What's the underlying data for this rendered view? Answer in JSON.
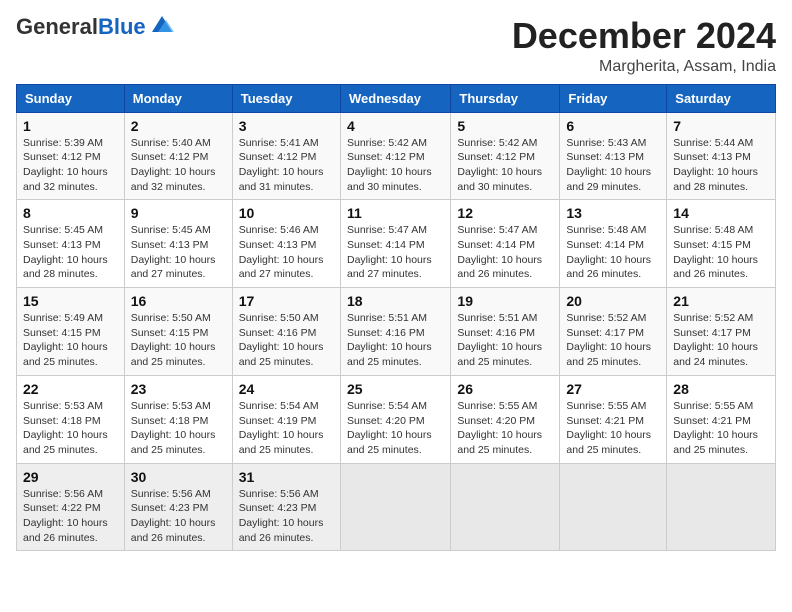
{
  "logo": {
    "general": "General",
    "blue": "Blue"
  },
  "header": {
    "month": "December 2024",
    "location": "Margherita, Assam, India"
  },
  "weekdays": [
    "Sunday",
    "Monday",
    "Tuesday",
    "Wednesday",
    "Thursday",
    "Friday",
    "Saturday"
  ],
  "weeks": [
    [
      {
        "day": "1",
        "sunrise": "Sunrise: 5:39 AM",
        "sunset": "Sunset: 4:12 PM",
        "daylight": "Daylight: 10 hours and 32 minutes."
      },
      {
        "day": "2",
        "sunrise": "Sunrise: 5:40 AM",
        "sunset": "Sunset: 4:12 PM",
        "daylight": "Daylight: 10 hours and 32 minutes."
      },
      {
        "day": "3",
        "sunrise": "Sunrise: 5:41 AM",
        "sunset": "Sunset: 4:12 PM",
        "daylight": "Daylight: 10 hours and 31 minutes."
      },
      {
        "day": "4",
        "sunrise": "Sunrise: 5:42 AM",
        "sunset": "Sunset: 4:12 PM",
        "daylight": "Daylight: 10 hours and 30 minutes."
      },
      {
        "day": "5",
        "sunrise": "Sunrise: 5:42 AM",
        "sunset": "Sunset: 4:12 PM",
        "daylight": "Daylight: 10 hours and 30 minutes."
      },
      {
        "day": "6",
        "sunrise": "Sunrise: 5:43 AM",
        "sunset": "Sunset: 4:13 PM",
        "daylight": "Daylight: 10 hours and 29 minutes."
      },
      {
        "day": "7",
        "sunrise": "Sunrise: 5:44 AM",
        "sunset": "Sunset: 4:13 PM",
        "daylight": "Daylight: 10 hours and 28 minutes."
      }
    ],
    [
      {
        "day": "8",
        "sunrise": "Sunrise: 5:45 AM",
        "sunset": "Sunset: 4:13 PM",
        "daylight": "Daylight: 10 hours and 28 minutes."
      },
      {
        "day": "9",
        "sunrise": "Sunrise: 5:45 AM",
        "sunset": "Sunset: 4:13 PM",
        "daylight": "Daylight: 10 hours and 27 minutes."
      },
      {
        "day": "10",
        "sunrise": "Sunrise: 5:46 AM",
        "sunset": "Sunset: 4:13 PM",
        "daylight": "Daylight: 10 hours and 27 minutes."
      },
      {
        "day": "11",
        "sunrise": "Sunrise: 5:47 AM",
        "sunset": "Sunset: 4:14 PM",
        "daylight": "Daylight: 10 hours and 27 minutes."
      },
      {
        "day": "12",
        "sunrise": "Sunrise: 5:47 AM",
        "sunset": "Sunset: 4:14 PM",
        "daylight": "Daylight: 10 hours and 26 minutes."
      },
      {
        "day": "13",
        "sunrise": "Sunrise: 5:48 AM",
        "sunset": "Sunset: 4:14 PM",
        "daylight": "Daylight: 10 hours and 26 minutes."
      },
      {
        "day": "14",
        "sunrise": "Sunrise: 5:48 AM",
        "sunset": "Sunset: 4:15 PM",
        "daylight": "Daylight: 10 hours and 26 minutes."
      }
    ],
    [
      {
        "day": "15",
        "sunrise": "Sunrise: 5:49 AM",
        "sunset": "Sunset: 4:15 PM",
        "daylight": "Daylight: 10 hours and 25 minutes."
      },
      {
        "day": "16",
        "sunrise": "Sunrise: 5:50 AM",
        "sunset": "Sunset: 4:15 PM",
        "daylight": "Daylight: 10 hours and 25 minutes."
      },
      {
        "day": "17",
        "sunrise": "Sunrise: 5:50 AM",
        "sunset": "Sunset: 4:16 PM",
        "daylight": "Daylight: 10 hours and 25 minutes."
      },
      {
        "day": "18",
        "sunrise": "Sunrise: 5:51 AM",
        "sunset": "Sunset: 4:16 PM",
        "daylight": "Daylight: 10 hours and 25 minutes."
      },
      {
        "day": "19",
        "sunrise": "Sunrise: 5:51 AM",
        "sunset": "Sunset: 4:16 PM",
        "daylight": "Daylight: 10 hours and 25 minutes."
      },
      {
        "day": "20",
        "sunrise": "Sunrise: 5:52 AM",
        "sunset": "Sunset: 4:17 PM",
        "daylight": "Daylight: 10 hours and 25 minutes."
      },
      {
        "day": "21",
        "sunrise": "Sunrise: 5:52 AM",
        "sunset": "Sunset: 4:17 PM",
        "daylight": "Daylight: 10 hours and 24 minutes."
      }
    ],
    [
      {
        "day": "22",
        "sunrise": "Sunrise: 5:53 AM",
        "sunset": "Sunset: 4:18 PM",
        "daylight": "Daylight: 10 hours and 25 minutes."
      },
      {
        "day": "23",
        "sunrise": "Sunrise: 5:53 AM",
        "sunset": "Sunset: 4:18 PM",
        "daylight": "Daylight: 10 hours and 25 minutes."
      },
      {
        "day": "24",
        "sunrise": "Sunrise: 5:54 AM",
        "sunset": "Sunset: 4:19 PM",
        "daylight": "Daylight: 10 hours and 25 minutes."
      },
      {
        "day": "25",
        "sunrise": "Sunrise: 5:54 AM",
        "sunset": "Sunset: 4:20 PM",
        "daylight": "Daylight: 10 hours and 25 minutes."
      },
      {
        "day": "26",
        "sunrise": "Sunrise: 5:55 AM",
        "sunset": "Sunset: 4:20 PM",
        "daylight": "Daylight: 10 hours and 25 minutes."
      },
      {
        "day": "27",
        "sunrise": "Sunrise: 5:55 AM",
        "sunset": "Sunset: 4:21 PM",
        "daylight": "Daylight: 10 hours and 25 minutes."
      },
      {
        "day": "28",
        "sunrise": "Sunrise: 5:55 AM",
        "sunset": "Sunset: 4:21 PM",
        "daylight": "Daylight: 10 hours and 25 minutes."
      }
    ],
    [
      {
        "day": "29",
        "sunrise": "Sunrise: 5:56 AM",
        "sunset": "Sunset: 4:22 PM",
        "daylight": "Daylight: 10 hours and 26 minutes."
      },
      {
        "day": "30",
        "sunrise": "Sunrise: 5:56 AM",
        "sunset": "Sunset: 4:23 PM",
        "daylight": "Daylight: 10 hours and 26 minutes."
      },
      {
        "day": "31",
        "sunrise": "Sunrise: 5:56 AM",
        "sunset": "Sunset: 4:23 PM",
        "daylight": "Daylight: 10 hours and 26 minutes."
      },
      null,
      null,
      null,
      null
    ]
  ]
}
